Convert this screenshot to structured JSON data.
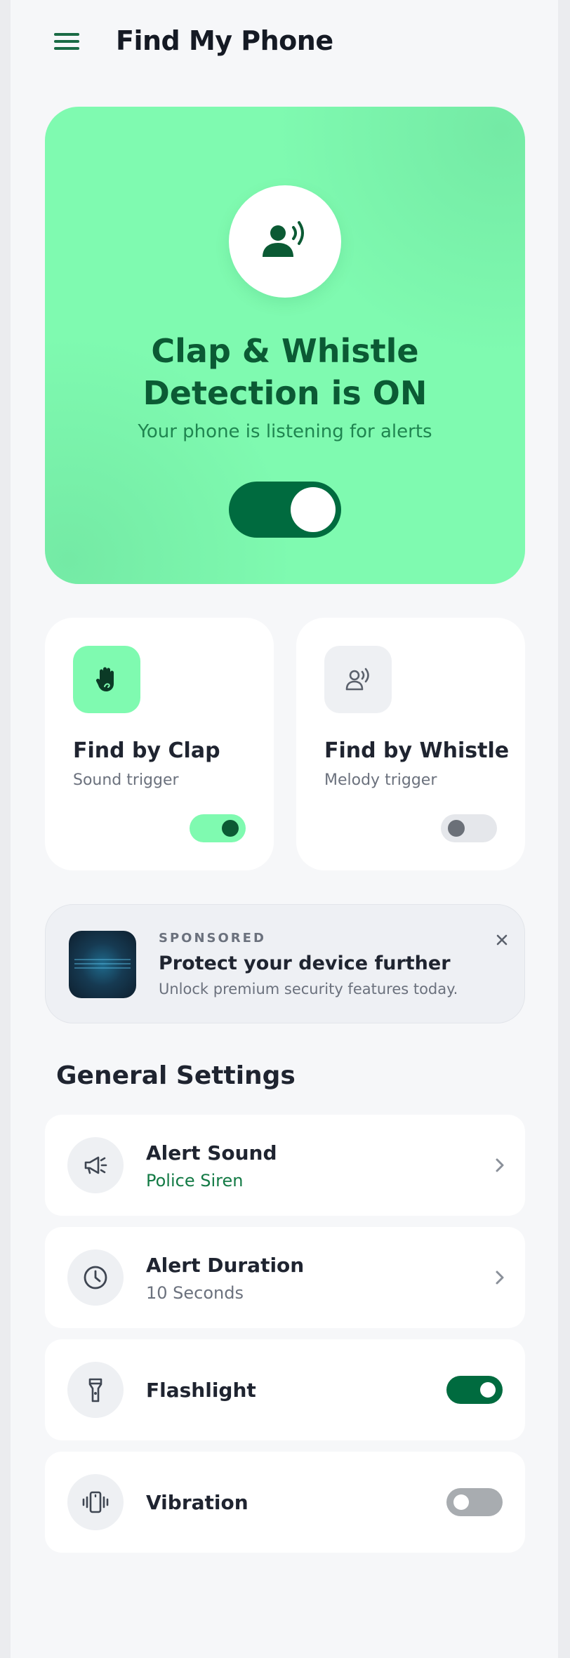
{
  "header": {
    "title": "Find My Phone",
    "menu_icon": "menu-icon"
  },
  "hero": {
    "icon": "voice-detect-icon",
    "title_line1": "Clap & Whistle",
    "title_line2": "Detection is ON",
    "subtitle": "Your phone is listening for alerts",
    "toggle_on": true
  },
  "modes": [
    {
      "title": "Find by Clap",
      "subtitle": "Sound trigger",
      "icon": "hand-icon",
      "enabled": true
    },
    {
      "title": "Find by Whistle",
      "subtitle": "Melody trigger",
      "icon": "whistle-icon",
      "enabled": false
    }
  ],
  "ad": {
    "label": "SPONSORED",
    "title": "Protect your device further",
    "description": "Unlock premium security features today.",
    "close_icon": "close-icon"
  },
  "settings": {
    "section_title": "General Settings",
    "items": [
      {
        "title": "Alert Sound",
        "value": "Police Siren",
        "icon": "megaphone-icon"
      },
      {
        "title": "Alert Duration",
        "value": "10 Seconds",
        "icon": "clock-icon"
      },
      {
        "title": "Flashlight",
        "icon": "flashlight-icon",
        "enabled": true
      },
      {
        "title": "Vibration",
        "icon": "vibration-icon",
        "enabled": false
      }
    ]
  },
  "colors": {
    "accent": "#006b3f",
    "accent_light": "#7ffab0",
    "hero_text": "#0b5a34",
    "background": "#f6f7f9"
  }
}
